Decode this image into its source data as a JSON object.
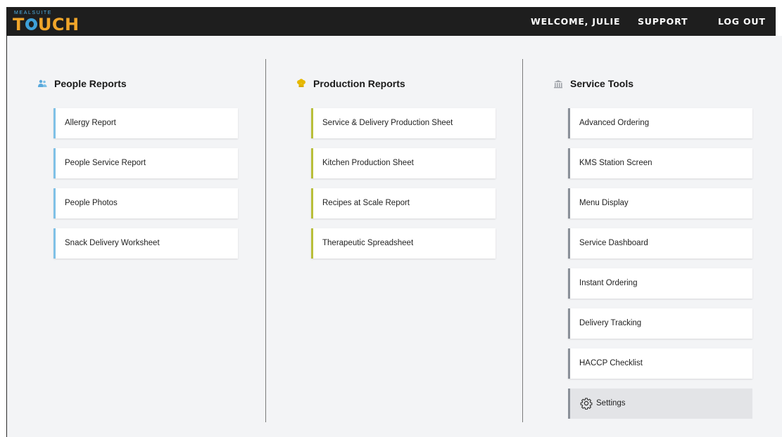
{
  "brand": {
    "small": "MEALSUITE",
    "big_pre": "T",
    "big_post": "UCH"
  },
  "header": {
    "welcome": "WELCOME, JULIE",
    "support": "SUPPORT",
    "logout": "LOG OUT"
  },
  "columns": {
    "people": {
      "title": "People Reports",
      "items": [
        "Allergy Report",
        "People Service Report",
        "People Photos",
        "Snack Delivery Worksheet"
      ]
    },
    "production": {
      "title": "Production Reports",
      "items": [
        "Service & Delivery Production Sheet",
        "Kitchen Production Sheet",
        "Recipes at Scale Report",
        "Therapeutic Spreadsheet"
      ]
    },
    "service": {
      "title": "Service Tools",
      "items": [
        "Advanced Ordering",
        "KMS Station Screen",
        "Menu Display",
        "Service Dashboard",
        "Instant Ordering",
        "Delivery Tracking",
        "HACCP Checklist",
        "Settings"
      ]
    }
  },
  "colors": {
    "people_accent": "#7fc1e6",
    "production_accent": "#b9bf3a",
    "service_accent": "#8a9099",
    "logo_orange": "#f0a52a"
  },
  "icons": {
    "people": "people-icon",
    "production": "chef-hat-icon",
    "service": "building-icon",
    "settings": "gear-icon"
  }
}
